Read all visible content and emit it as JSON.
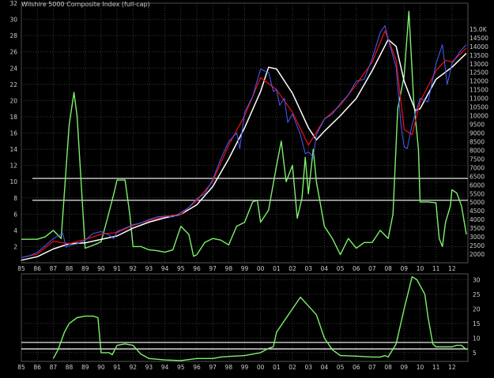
{
  "chart_data": [
    {
      "type": "line",
      "title": "Wilshire 5000 Composite Index (full-cap)",
      "left_axis": {
        "range": [
          0,
          32
        ],
        "ticks": [
          2,
          4,
          6,
          8,
          10,
          12,
          14,
          16,
          18,
          20,
          22,
          24,
          26,
          28,
          30,
          32
        ]
      },
      "right_axis": {
        "range": [
          1500,
          16500
        ],
        "ticks": [
          "2000",
          "2500",
          "3000",
          "3500",
          "4000",
          "4500",
          "5000",
          "5500",
          "6000",
          "6500",
          "7000",
          "7500",
          "8000",
          "8500",
          "9000",
          "9500",
          "10000",
          "10500",
          "11000",
          "11500",
          "12000",
          "12500",
          "13000",
          "13500",
          "14000",
          "14500",
          "15.0K"
        ]
      },
      "x_axis": {
        "range": [
          1985,
          2013
        ],
        "ticks": [
          "85",
          "86",
          "87",
          "88",
          "89",
          "90",
          "91",
          "92",
          "93",
          "94",
          "95",
          "96",
          "97",
          "98",
          "99",
          "00",
          "01",
          "02",
          "03",
          "04",
          "05",
          "06",
          "07",
          "08",
          "09",
          "10",
          "11",
          "12"
        ]
      },
      "horizontal_lines_left_axis": [
        10.4,
        7.7
      ],
      "grid": true,
      "colors": {
        "price": "#4a5cff",
        "fast_average": "#e01010",
        "slow_average": "#ffffff",
        "oscillator": "#7cf06a",
        "grid": "#3a3a3a",
        "text": "#cccccc"
      },
      "series": [
        {
          "axis": "right",
          "color_key": "price",
          "x": [
            1985,
            1985.5,
            1986,
            1986.5,
            1987,
            1987.6,
            1987.8,
            1988,
            1988.5,
            1989,
            1989.5,
            1990,
            1990.5,
            1990.8,
            1991,
            1991.5,
            1992,
            1992.5,
            1993,
            1993.5,
            1994,
            1994.5,
            1995,
            1995.5,
            1996,
            1996.5,
            1997,
            1997.5,
            1998,
            1998.5,
            1998.7,
            1999,
            1999.5,
            2000,
            2000.2,
            2000.5,
            2000.8,
            2001,
            2001.2,
            2001.5,
            2001.7,
            2002,
            2002.5,
            2002.8,
            2003,
            2003.3,
            2003.5,
            2004,
            2004.5,
            2005,
            2005.5,
            2006,
            2006.5,
            2007,
            2007.5,
            2007.8,
            2008,
            2008.5,
            2008.8,
            2009,
            2009.2,
            2009.5,
            2010,
            2010.5,
            2011,
            2011.4,
            2011.7,
            2012,
            2012.5,
            2012.9
          ],
          "y": [
            1800,
            1900,
            2100,
            2500,
            2900,
            3200,
            2400,
            2500,
            2600,
            2800,
            3200,
            3300,
            3100,
            2900,
            3300,
            3500,
            3700,
            3800,
            4000,
            4150,
            4200,
            4150,
            4400,
            4700,
            5200,
            5500,
            6300,
            7500,
            8500,
            9000,
            8100,
            10200,
            11100,
            12700,
            12600,
            12500,
            11400,
            11500,
            10600,
            11000,
            9600,
            10100,
            8900,
            7800,
            7900,
            7600,
            8900,
            9800,
            10100,
            10700,
            11200,
            12000,
            12100,
            13300,
            14800,
            15200,
            14400,
            12800,
            9500,
            8200,
            8100,
            9500,
            11000,
            10800,
            13000,
            14100,
            11800,
            13000,
            13700,
            14100
          ]
        },
        {
          "axis": "right",
          "color_key": "fast_average",
          "x": [
            1985,
            1986,
            1987,
            1988,
            1989,
            1990,
            1991,
            1992,
            1993,
            1994,
            1995,
            1996,
            1997,
            1998,
            1999,
            2000,
            2001,
            2002,
            2003,
            2004,
            2005,
            2006,
            2007,
            2007.8,
            2008.5,
            2009,
            2009.5,
            2010,
            2011,
            2011.6,
            2012,
            2012.9
          ],
          "y": [
            1800,
            2000,
            2750,
            2600,
            2850,
            3150,
            3250,
            3650,
            3950,
            4180,
            4300,
            5100,
            6200,
            8300,
            10000,
            12200,
            11500,
            10200,
            8300,
            9800,
            10600,
            11800,
            13100,
            14900,
            13200,
            9200,
            8900,
            10800,
            12600,
            13200,
            13100,
            13900
          ]
        },
        {
          "axis": "right",
          "color_key": "slow_average",
          "x": [
            1985,
            1986,
            1987,
            1988,
            1989,
            1990,
            1991,
            1992,
            1993,
            1994,
            1995,
            1996,
            1997,
            1998,
            1999,
            2000,
            2000.5,
            2001,
            2002,
            2003,
            2003.5,
            2004,
            2005,
            2006,
            2007,
            2008,
            2008.5,
            2009,
            2009.7,
            2010,
            2011,
            2012,
            2012.9
          ],
          "y": [
            1650,
            1850,
            2300,
            2600,
            2650,
            2850,
            3050,
            3500,
            3850,
            4100,
            4300,
            4850,
            5900,
            7500,
            9300,
            11400,
            12800,
            12700,
            11300,
            9300,
            8600,
            9100,
            10000,
            11000,
            12600,
            14400,
            14000,
            12000,
            10300,
            10400,
            12100,
            12800,
            13600
          ]
        },
        {
          "axis": "left",
          "color_key": "oscillator",
          "x": [
            1985,
            1986,
            1986.5,
            1987,
            1987.5,
            1988,
            1988.3,
            1988.5,
            1989,
            1989.3,
            1989.8,
            1990,
            1990.4,
            1990.8,
            1991,
            1991.5,
            1991.8,
            1992,
            1992.5,
            1993,
            1993.5,
            1994,
            1994.5,
            1995,
            1995.5,
            1995.8,
            1996,
            1996.5,
            1997,
            1997.5,
            1998,
            1998.5,
            1999,
            1999.5,
            1999.8,
            2000,
            2000.5,
            2001,
            2001.3,
            2001.6,
            2002,
            2002.3,
            2002.6,
            2002.8,
            2003,
            2003.3,
            2003.5,
            2004,
            2004.5,
            2005,
            2005.5,
            2006,
            2006.5,
            2007,
            2007.5,
            2008,
            2008.3,
            2008.6,
            2009,
            2009.3,
            2009.6,
            2009.9,
            2010,
            2010.5,
            2011,
            2011.2,
            2011.4,
            2011.6,
            2011.9,
            2012,
            2012.3,
            2012.6,
            2012.9
          ],
          "y": [
            2.9,
            2.9,
            3.2,
            4.0,
            3.0,
            17,
            21,
            18,
            1.8,
            2.0,
            2.4,
            2.6,
            5.5,
            8.5,
            10.2,
            10.2,
            6.0,
            2.0,
            2.0,
            1.6,
            1.5,
            1.3,
            1.6,
            4.5,
            3.5,
            0.8,
            1.0,
            2.5,
            3.0,
            2.8,
            2.2,
            4.5,
            5.0,
            7.5,
            7.7,
            5.0,
            6.5,
            12,
            15,
            10,
            12,
            5.5,
            8,
            13,
            8.5,
            14,
            10,
            4.5,
            3.0,
            1.0,
            3.0,
            1.8,
            2.5,
            2.5,
            4.0,
            3.0,
            6.0,
            19,
            23,
            31,
            20,
            14,
            7.5,
            7.5,
            7.4,
            3.0,
            2.0,
            5.0,
            7.0,
            9.0,
            8.6,
            7.0,
            3.5
          ]
        }
      ]
    },
    {
      "type": "line",
      "y_axis": {
        "range": [
          2,
          32
        ],
        "ticks": [
          "5",
          "10",
          "15",
          "20",
          "25",
          "30"
        ]
      },
      "x_axis": {
        "range": [
          1985,
          2013
        ],
        "ticks": [
          "85",
          "86",
          "87",
          "88",
          "89",
          "90",
          "91",
          "92",
          "93",
          "94",
          "95",
          "96",
          "97",
          "98",
          "99",
          "00",
          "01",
          "02",
          "03",
          "04",
          "05",
          "06",
          "07",
          "08",
          "09",
          "10",
          "11",
          "12"
        ]
      },
      "horizontal_lines": [
        8.5,
        6.3
      ],
      "grid": true,
      "series": [
        {
          "color_key": "oscillator",
          "x": [
            1987,
            1987.3,
            1987.7,
            1988,
            1988.5,
            1989,
            1989.5,
            1989.8,
            1990,
            1990.5,
            1990.7,
            1991,
            1991.5,
            1992,
            1992.5,
            1993,
            1994,
            1995,
            1996,
            1997,
            1997.5,
            1998,
            1999,
            2000,
            2000.5,
            2000.8,
            2001,
            2001.5,
            2002,
            2002.5,
            2003,
            2003.5,
            2004,
            2004.5,
            2005,
            2006,
            2007,
            2007.5,
            2007.8,
            2008,
            2008.5,
            2009,
            2009.5,
            2009.8,
            2010,
            2010.3,
            2010.5,
            2010.8,
            2011,
            2011.5,
            2012,
            2012.3,
            2012.6,
            2012.9
          ],
          "y": [
            3,
            6,
            12,
            15,
            17,
            17.5,
            17.5,
            17,
            5,
            5,
            4.3,
            7.5,
            8,
            7.5,
            4.5,
            3,
            2.5,
            2.3,
            3,
            3,
            3.5,
            3.7,
            4,
            5,
            6.5,
            7,
            12,
            16,
            20,
            24,
            21,
            18,
            10,
            6,
            4,
            3.8,
            3.5,
            3.5,
            4,
            3.5,
            8,
            20,
            31,
            30,
            28,
            25,
            17,
            8,
            7,
            7,
            7,
            7.5,
            7.5,
            6
          ]
        }
      ]
    }
  ]
}
